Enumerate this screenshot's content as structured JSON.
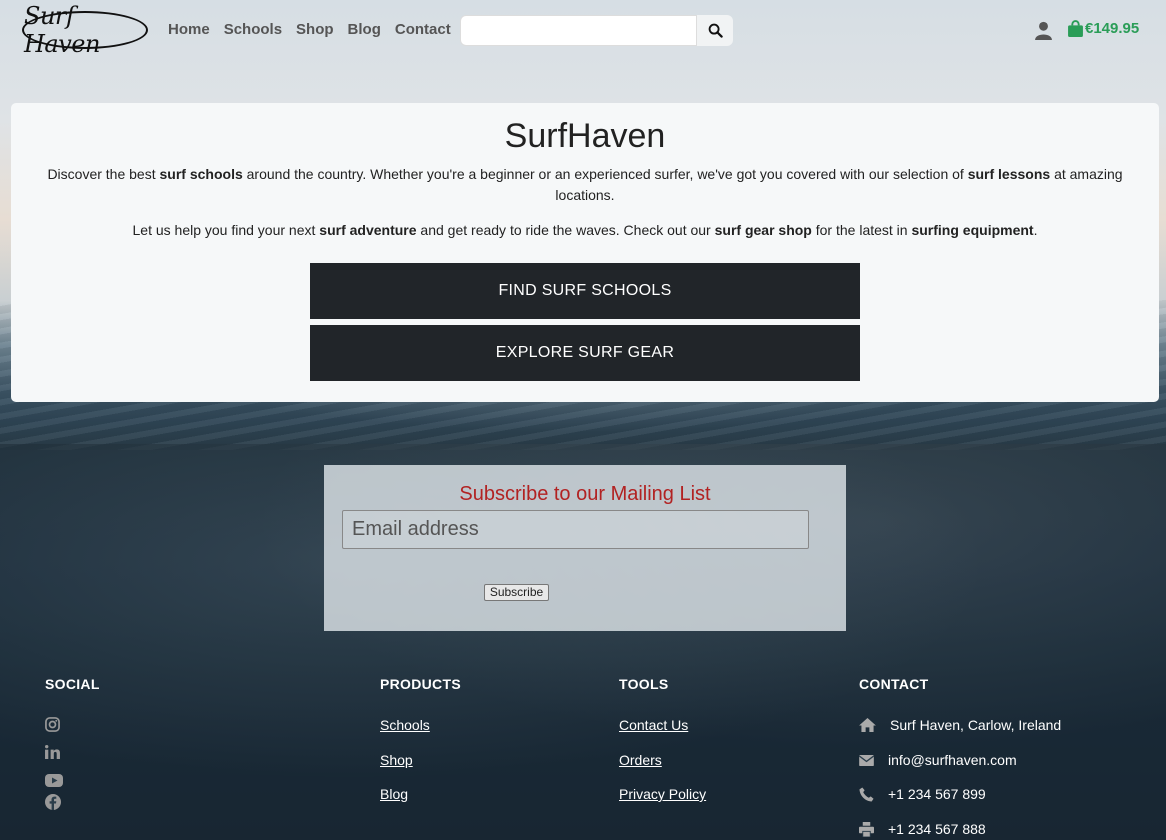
{
  "brand": {
    "logo_text": "Surf Haven"
  },
  "nav": {
    "links": [
      "Home",
      "Schools",
      "Shop",
      "Blog",
      "Contact"
    ]
  },
  "search": {
    "placeholder": ""
  },
  "cart": {
    "total": "€149.95"
  },
  "hero": {
    "title": "SurfHaven",
    "para1": [
      {
        "t": "Discover the best ",
        "b": false
      },
      {
        "t": "surf schools",
        "b": true
      },
      {
        "t": " around the country. Whether you're a beginner or an experienced surfer, we've got you covered with our selection of ",
        "b": false
      },
      {
        "t": "surf lessons",
        "b": true
      },
      {
        "t": " at amazing locations.",
        "b": false
      }
    ],
    "para2": [
      {
        "t": "Let us help you find your next ",
        "b": false
      },
      {
        "t": "surf adventure",
        "b": true
      },
      {
        "t": " and get ready to ride the waves. Check out our ",
        "b": false
      },
      {
        "t": "surf gear shop",
        "b": true
      },
      {
        "t": " for the latest in ",
        "b": false
      },
      {
        "t": "surfing equipment",
        "b": true
      },
      {
        "t": ".",
        "b": false
      }
    ],
    "button1": "FIND SURF SCHOOLS",
    "button2": "EXPLORE SURF GEAR"
  },
  "subscribe": {
    "title": "Subscribe to our Mailing List",
    "placeholder": "Email address",
    "button": "Subscribe"
  },
  "footer": {
    "social": {
      "title": "SOCIAL",
      "icons": [
        "instagram-icon",
        "linkedin-icon",
        "youtube-icon",
        "facebook-icon"
      ]
    },
    "products": {
      "title": "PRODUCTS",
      "links": [
        "Schools",
        "Shop",
        "Blog"
      ]
    },
    "tools": {
      "title": "TOOLS",
      "links": [
        "Contact Us",
        "Orders",
        "Privacy Policy"
      ]
    },
    "contact": {
      "title": "CONTACT",
      "address": "Surf Haven, Carlow, Ireland",
      "email": "info@surfhaven.com",
      "phone": "+1 234 567 899",
      "fax": "+1 234 567 888"
    }
  },
  "colors": {
    "accent": "#2a9d57",
    "subscribe_title": "#b22222",
    "button_bg": "#212529"
  }
}
